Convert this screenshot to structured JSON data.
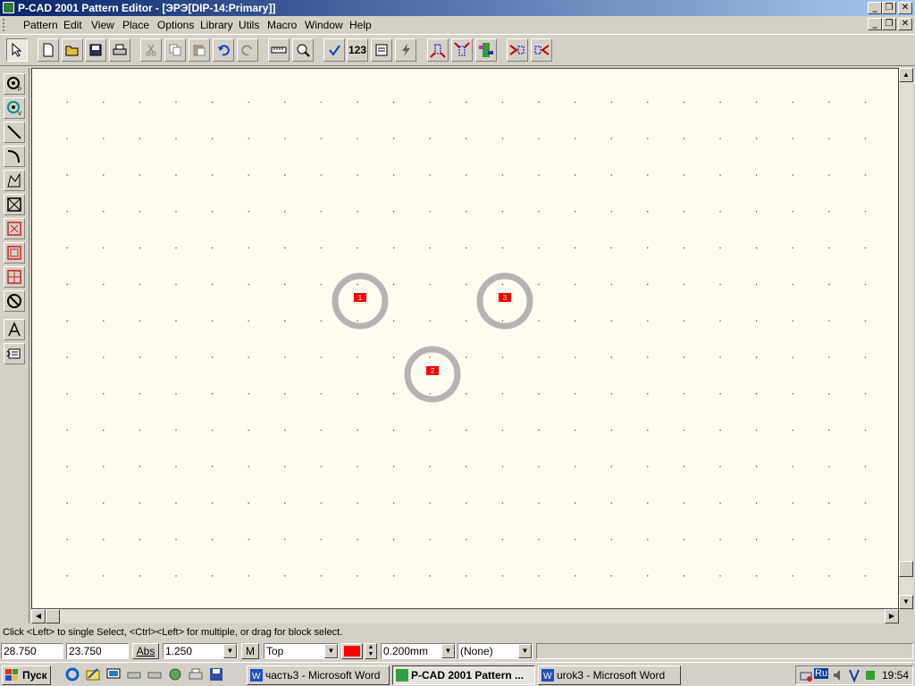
{
  "window": {
    "title": "P-CAD 2001 Pattern Editor - [ЭРЭ[DIP-14:Primary]]",
    "minimize": "_",
    "restore": "❐",
    "close": "✕"
  },
  "menu": [
    "Pattern",
    "Edit",
    "View",
    "Place",
    "Options",
    "Library",
    "Utils",
    "Macro",
    "Window",
    "Help"
  ],
  "toolbar": {
    "counter_label": "123",
    "icons": [
      "select-icon",
      "new-icon",
      "open-icon",
      "save-icon",
      "print-icon",
      "cut-icon",
      "copy-icon",
      "paste-icon",
      "undo-icon",
      "redo-icon",
      "measure-icon",
      "zoom-icon",
      "check-icon",
      "renumber-icon",
      "pattern-wizard-icon",
      "lightning-icon",
      "pad-style-icon",
      "via-style-icon",
      "layers-icon",
      "mirror-icon",
      "flip-icon"
    ]
  },
  "left_tools": [
    "place-pad-icon",
    "place-via-icon",
    "line-icon",
    "arc-icon",
    "polygon-icon",
    "copper-pour-icon",
    "cutout-icon",
    "keepout-icon",
    "plane-icon",
    "no-entry-icon",
    "text-icon",
    "attribute-icon"
  ],
  "pads": [
    {
      "label": "1"
    },
    {
      "label": "2"
    },
    {
      "label": "3"
    }
  ],
  "status": {
    "message": "Click <Left> to single Select, <Ctrl><Left> for multiple, or drag for block select."
  },
  "controls": {
    "x_coord": "28.750",
    "y_coord": "23.750",
    "abs_label": "Abs",
    "grid": "1.250",
    "m_label": "M",
    "layer": "Top",
    "layer_color": "#ff0000",
    "line_width": "0.200mm",
    "net": "(None)"
  },
  "taskbar": {
    "start": "Пуск",
    "tasks": [
      {
        "label": "часть3 - Microsoft Word",
        "active": false
      },
      {
        "label": "P-CAD 2001 Pattern ...",
        "active": true
      },
      {
        "label": "urok3 - Microsoft Word",
        "active": false
      }
    ],
    "tray_lang": "Ru",
    "clock": "19:54"
  }
}
